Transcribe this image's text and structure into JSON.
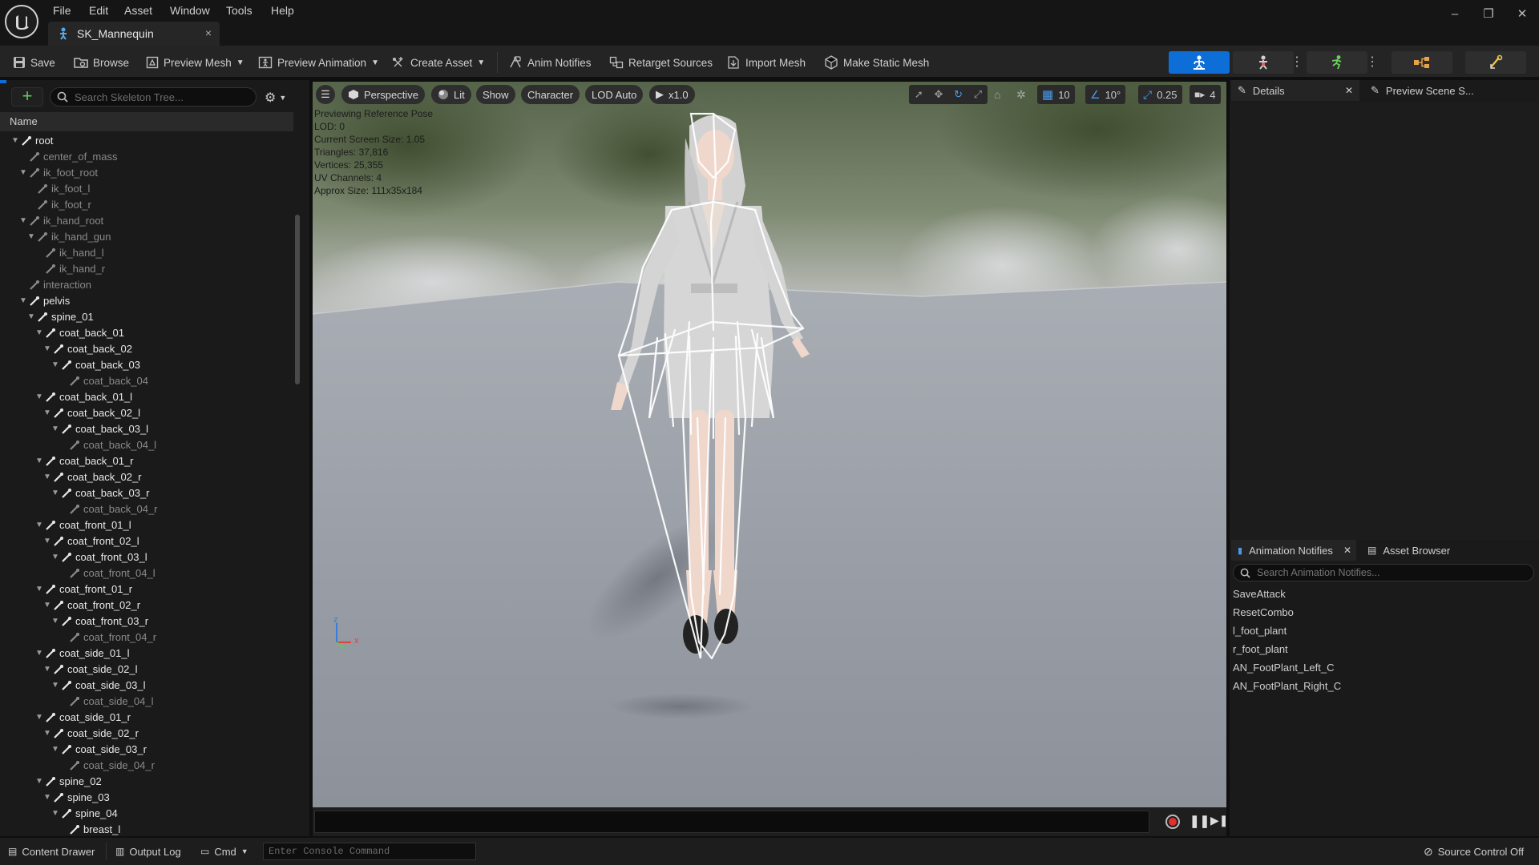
{
  "menu": [
    "File",
    "Edit",
    "Asset",
    "Window",
    "Tools",
    "Help"
  ],
  "document_tab": {
    "title": "SK_Mannequin",
    "close": "×"
  },
  "window_controls": [
    "–",
    "❐",
    "✕"
  ],
  "toolbar": {
    "save": "Save",
    "browse": "Browse",
    "preview_mesh": "Preview Mesh",
    "preview_animation": "Preview Animation",
    "create_asset": "Create Asset",
    "anim_notifies": "Anim Notifies",
    "retarget_sources": "Retarget Sources",
    "import_mesh": "Import Mesh",
    "make_static_mesh": "Make Static Mesh"
  },
  "colors": {
    "accent": "#0e6ed8",
    "bone_active": "#e8e8e8",
    "bone_leaf": "#8a8a8a",
    "record": "#e03030"
  },
  "skeleton_tree": {
    "search_placeholder": "Search Skeleton Tree...",
    "column_name": "Name",
    "rows": [
      {
        "name": "root",
        "depth": 0,
        "expand": true,
        "leaf": false
      },
      {
        "name": "center_of_mass",
        "depth": 1,
        "expand": false,
        "leaf": true
      },
      {
        "name": "ik_foot_root",
        "depth": 1,
        "expand": true,
        "leaf": true
      },
      {
        "name": "ik_foot_l",
        "depth": 2,
        "expand": false,
        "leaf": true
      },
      {
        "name": "ik_foot_r",
        "depth": 2,
        "expand": false,
        "leaf": true
      },
      {
        "name": "ik_hand_root",
        "depth": 1,
        "expand": true,
        "leaf": true
      },
      {
        "name": "ik_hand_gun",
        "depth": 2,
        "expand": true,
        "leaf": true
      },
      {
        "name": "ik_hand_l",
        "depth": 3,
        "expand": false,
        "leaf": true
      },
      {
        "name": "ik_hand_r",
        "depth": 3,
        "expand": false,
        "leaf": true
      },
      {
        "name": "interaction",
        "depth": 1,
        "expand": false,
        "leaf": true
      },
      {
        "name": "pelvis",
        "depth": 1,
        "expand": true,
        "leaf": false
      },
      {
        "name": "spine_01",
        "depth": 2,
        "expand": true,
        "leaf": false
      },
      {
        "name": "coat_back_01",
        "depth": 3,
        "expand": true,
        "leaf": false
      },
      {
        "name": "coat_back_02",
        "depth": 4,
        "expand": true,
        "leaf": false
      },
      {
        "name": "coat_back_03",
        "depth": 5,
        "expand": true,
        "leaf": false
      },
      {
        "name": "coat_back_04",
        "depth": 6,
        "expand": false,
        "leaf": true
      },
      {
        "name": "coat_back_01_l",
        "depth": 3,
        "expand": true,
        "leaf": false
      },
      {
        "name": "coat_back_02_l",
        "depth": 4,
        "expand": true,
        "leaf": false
      },
      {
        "name": "coat_back_03_l",
        "depth": 5,
        "expand": true,
        "leaf": false
      },
      {
        "name": "coat_back_04_l",
        "depth": 6,
        "expand": false,
        "leaf": true
      },
      {
        "name": "coat_back_01_r",
        "depth": 3,
        "expand": true,
        "leaf": false
      },
      {
        "name": "coat_back_02_r",
        "depth": 4,
        "expand": true,
        "leaf": false
      },
      {
        "name": "coat_back_03_r",
        "depth": 5,
        "expand": true,
        "leaf": false
      },
      {
        "name": "coat_back_04_r",
        "depth": 6,
        "expand": false,
        "leaf": true
      },
      {
        "name": "coat_front_01_l",
        "depth": 3,
        "expand": true,
        "leaf": false
      },
      {
        "name": "coat_front_02_l",
        "depth": 4,
        "expand": true,
        "leaf": false
      },
      {
        "name": "coat_front_03_l",
        "depth": 5,
        "expand": true,
        "leaf": false
      },
      {
        "name": "coat_front_04_l",
        "depth": 6,
        "expand": false,
        "leaf": true
      },
      {
        "name": "coat_front_01_r",
        "depth": 3,
        "expand": true,
        "leaf": false
      },
      {
        "name": "coat_front_02_r",
        "depth": 4,
        "expand": true,
        "leaf": false
      },
      {
        "name": "coat_front_03_r",
        "depth": 5,
        "expand": true,
        "leaf": false
      },
      {
        "name": "coat_front_04_r",
        "depth": 6,
        "expand": false,
        "leaf": true
      },
      {
        "name": "coat_side_01_l",
        "depth": 3,
        "expand": true,
        "leaf": false
      },
      {
        "name": "coat_side_02_l",
        "depth": 4,
        "expand": true,
        "leaf": false
      },
      {
        "name": "coat_side_03_l",
        "depth": 5,
        "expand": true,
        "leaf": false
      },
      {
        "name": "coat_side_04_l",
        "depth": 6,
        "expand": false,
        "leaf": true
      },
      {
        "name": "coat_side_01_r",
        "depth": 3,
        "expand": true,
        "leaf": false
      },
      {
        "name": "coat_side_02_r",
        "depth": 4,
        "expand": true,
        "leaf": false
      },
      {
        "name": "coat_side_03_r",
        "depth": 5,
        "expand": true,
        "leaf": false
      },
      {
        "name": "coat_side_04_r",
        "depth": 6,
        "expand": false,
        "leaf": true
      },
      {
        "name": "spine_02",
        "depth": 3,
        "expand": true,
        "leaf": false
      },
      {
        "name": "spine_03",
        "depth": 4,
        "expand": true,
        "leaf": false
      },
      {
        "name": "spine_04",
        "depth": 5,
        "expand": true,
        "leaf": false
      },
      {
        "name": "breast_l",
        "depth": 6,
        "expand": false,
        "leaf": false
      }
    ]
  },
  "viewport": {
    "perspective": "Perspective",
    "lit": "Lit",
    "show": "Show",
    "character": "Character",
    "lod": "LOD Auto",
    "speed": "x1.0",
    "grid_snap": "10",
    "rotation_snap": "10°",
    "scale_snap": "0.25",
    "camera_speed": "4",
    "stats": [
      "Previewing Reference Pose",
      "LOD: 0",
      "Current Screen Size: 1.05",
      "Triangles: 37,816",
      "Vertices: 25,355",
      "UV Channels: 4",
      "Approx Size: 111x35x184"
    ],
    "axis": {
      "x": "x",
      "z": "z"
    }
  },
  "details": {
    "tab": "Details",
    "preview_tab": "Preview Scene S..."
  },
  "notifies": {
    "tab": "Animation Notifies",
    "asset_browser": "Asset Browser",
    "search_placeholder": "Search Animation Notifies...",
    "items": [
      "SaveAttack",
      "ResetCombo",
      "l_foot_plant",
      "r_foot_plant",
      "AN_FootPlant_Left_C",
      "AN_FootPlant_Right_C"
    ]
  },
  "statusbar": {
    "content_drawer": "Content Drawer",
    "output_log": "Output Log",
    "cmd": "Cmd",
    "console_placeholder": "Enter Console Command",
    "source_control": "Source Control Off"
  }
}
